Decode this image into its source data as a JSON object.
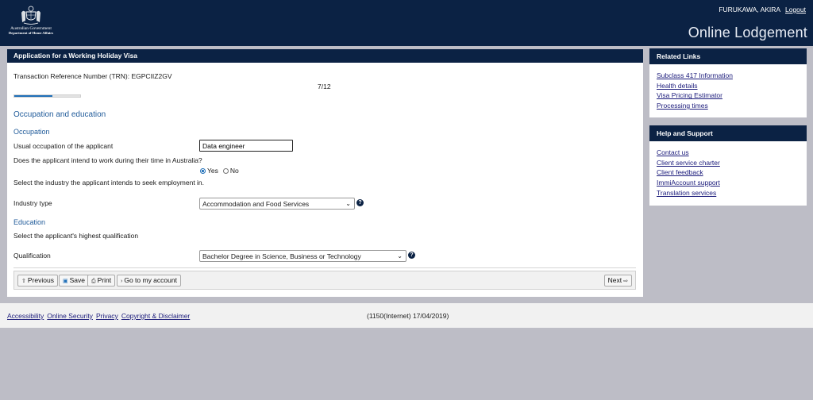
{
  "header": {
    "gov_name": "Australian Government",
    "dept_name": "Department of Home Affairs",
    "user_name": "FURUKAWA, AKIRA",
    "logout_label": "Logout",
    "app_title": "Online Lodgement"
  },
  "form": {
    "title": "Application for a Working Holiday Visa",
    "trn_text": "Transaction Reference Number (TRN): EGPCIIZ2GV",
    "page_indicator": "7/12",
    "progress_fraction": 0.58,
    "section_title": "Occupation and education",
    "occupation": {
      "subtitle": "Occupation",
      "usual_label": "Usual occupation of the applicant",
      "usual_value": "Data engineer",
      "work_question": "Does the applicant intend to work during their time in Australia?",
      "yes_label": "Yes",
      "no_label": "No",
      "selected": "Yes",
      "industry_prompt": "Select the industry the applicant intends to seek employment in.",
      "industry_label": "Industry type",
      "industry_value": "Accommodation and Food Services"
    },
    "education": {
      "subtitle": "Education",
      "prompt": "Select the applicant's highest qualification",
      "qualification_label": "Qualification",
      "qualification_value": "Bachelor Degree in Science, Business or Technology"
    },
    "toolbar": {
      "previous": "Previous",
      "save": "Save",
      "print": "Print",
      "go_account": "Go to my account",
      "next": "Next"
    }
  },
  "related_links": {
    "title": "Related Links",
    "items": [
      "Subclass 417 Information",
      "Health details",
      "Visa Pricing Estimator",
      "Processing times"
    ]
  },
  "help_support": {
    "title": "Help and Support",
    "items": [
      "Contact us",
      "Client service charter",
      "Client feedback",
      "ImmiAccount support",
      "Translation services"
    ]
  },
  "footer": {
    "links": [
      "Accessibility",
      "Online Security",
      "Privacy",
      "Copyright & Disclaimer"
    ],
    "version": "(1150(Internet) 17/04/2019)"
  },
  "colors": {
    "navy": "#0b2244",
    "accent": "#1f6fb8",
    "page_bg": "#bdbdc6"
  }
}
